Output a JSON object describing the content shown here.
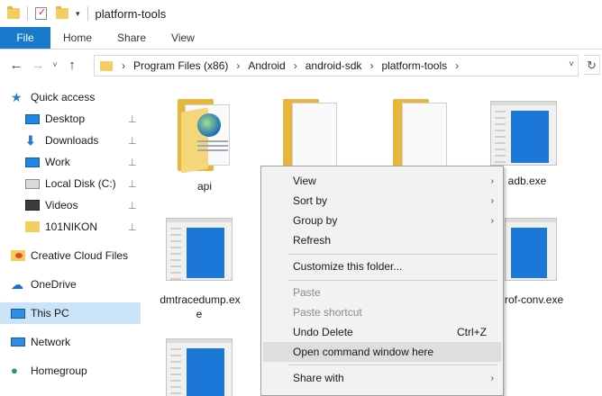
{
  "titlebar": {
    "title": "platform-tools",
    "dropdown_glyph": "▾"
  },
  "ribbon": {
    "tabs": [
      "File",
      "Home",
      "Share",
      "View"
    ]
  },
  "navbar": {
    "back": "←",
    "forward": "→",
    "recent": "˅",
    "up": "↑",
    "crumbs": [
      "Program Files (x86)",
      "Android",
      "android-sdk",
      "platform-tools"
    ],
    "crumb_sep": "›",
    "expand": "˅",
    "refresh": "↻"
  },
  "sidebar": {
    "quick_access": "Quick access",
    "pinned": [
      {
        "label": "Desktop",
        "icon": "desktop-icon"
      },
      {
        "label": "Downloads",
        "icon": "download-icon"
      },
      {
        "label": "Work",
        "icon": "monitor-icon"
      },
      {
        "label": "Local Disk (C:)",
        "icon": "disk-icon"
      },
      {
        "label": "Videos",
        "icon": "video-icon"
      },
      {
        "label": "101NIKON",
        "icon": "folder-icon"
      }
    ],
    "pin_glyph": "📌",
    "creative_cloud": "Creative Cloud Files",
    "onedrive": "OneDrive",
    "this_pc": "This PC",
    "network": "Network",
    "homegroup": "Homegroup"
  },
  "files": {
    "api": "api",
    "adb": "adb.exe",
    "dmtracedump_line1": "dmtracedump.ex",
    "dmtracedump_line2": "e",
    "hprof_partial": "rof-conv.exe"
  },
  "context_menu": {
    "view": "View",
    "sort_by": "Sort by",
    "group_by": "Group by",
    "refresh": "Refresh",
    "customize": "Customize this folder...",
    "paste": "Paste",
    "paste_shortcut": "Paste shortcut",
    "undo_delete": "Undo Delete",
    "undo_shortcut": "Ctrl+Z",
    "open_cmd": "Open command window here",
    "share_with": "Share with",
    "submenu_arrow": "›"
  },
  "colors": {
    "file_tab": "#1979ca",
    "selected": "#cce4f7",
    "menu_bg": "#f2f2f2",
    "menu_hover": "#dedede"
  }
}
